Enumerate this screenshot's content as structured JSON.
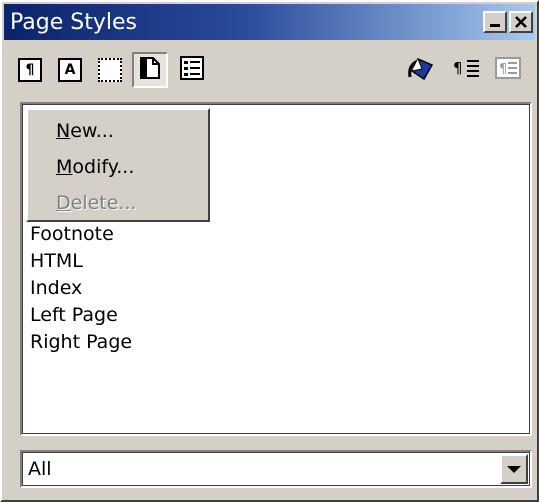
{
  "window": {
    "title": "Page Styles",
    "minimize_icon": "minimize-icon",
    "close_icon": "close-icon"
  },
  "toolbar": {
    "buttons": [
      {
        "icon": "paragraph-styles-icon",
        "glyph": "¶",
        "pressed": false
      },
      {
        "icon": "character-styles-icon",
        "glyph": "A",
        "pressed": false
      },
      {
        "icon": "frame-styles-icon",
        "glyph": "",
        "pressed": false
      },
      {
        "icon": "page-styles-icon",
        "glyph": "",
        "pressed": true
      },
      {
        "icon": "numbering-styles-icon",
        "glyph": "",
        "pressed": false
      }
    ],
    "right_buttons": [
      {
        "icon": "fill-format-mode-icon"
      },
      {
        "icon": "new-style-from-selection-icon"
      },
      {
        "icon": "update-style-icon"
      }
    ]
  },
  "context_menu": {
    "items": [
      {
        "prefix": "",
        "underline": "N",
        "rest": "ew...",
        "enabled": true
      },
      {
        "prefix": "",
        "underline": "M",
        "rest": "odify...",
        "enabled": true
      },
      {
        "prefix": "",
        "underline": "D",
        "rest": "elete...",
        "enabled": false
      }
    ]
  },
  "styles_list": [
    "Footnote",
    "HTML",
    "Index",
    "Left Page",
    "Right Page"
  ],
  "filter": {
    "value": "All"
  },
  "colors": {
    "titlebar_start": "#0a246a",
    "titlebar_end": "#a6caf0",
    "face": "#d4d0c8"
  }
}
